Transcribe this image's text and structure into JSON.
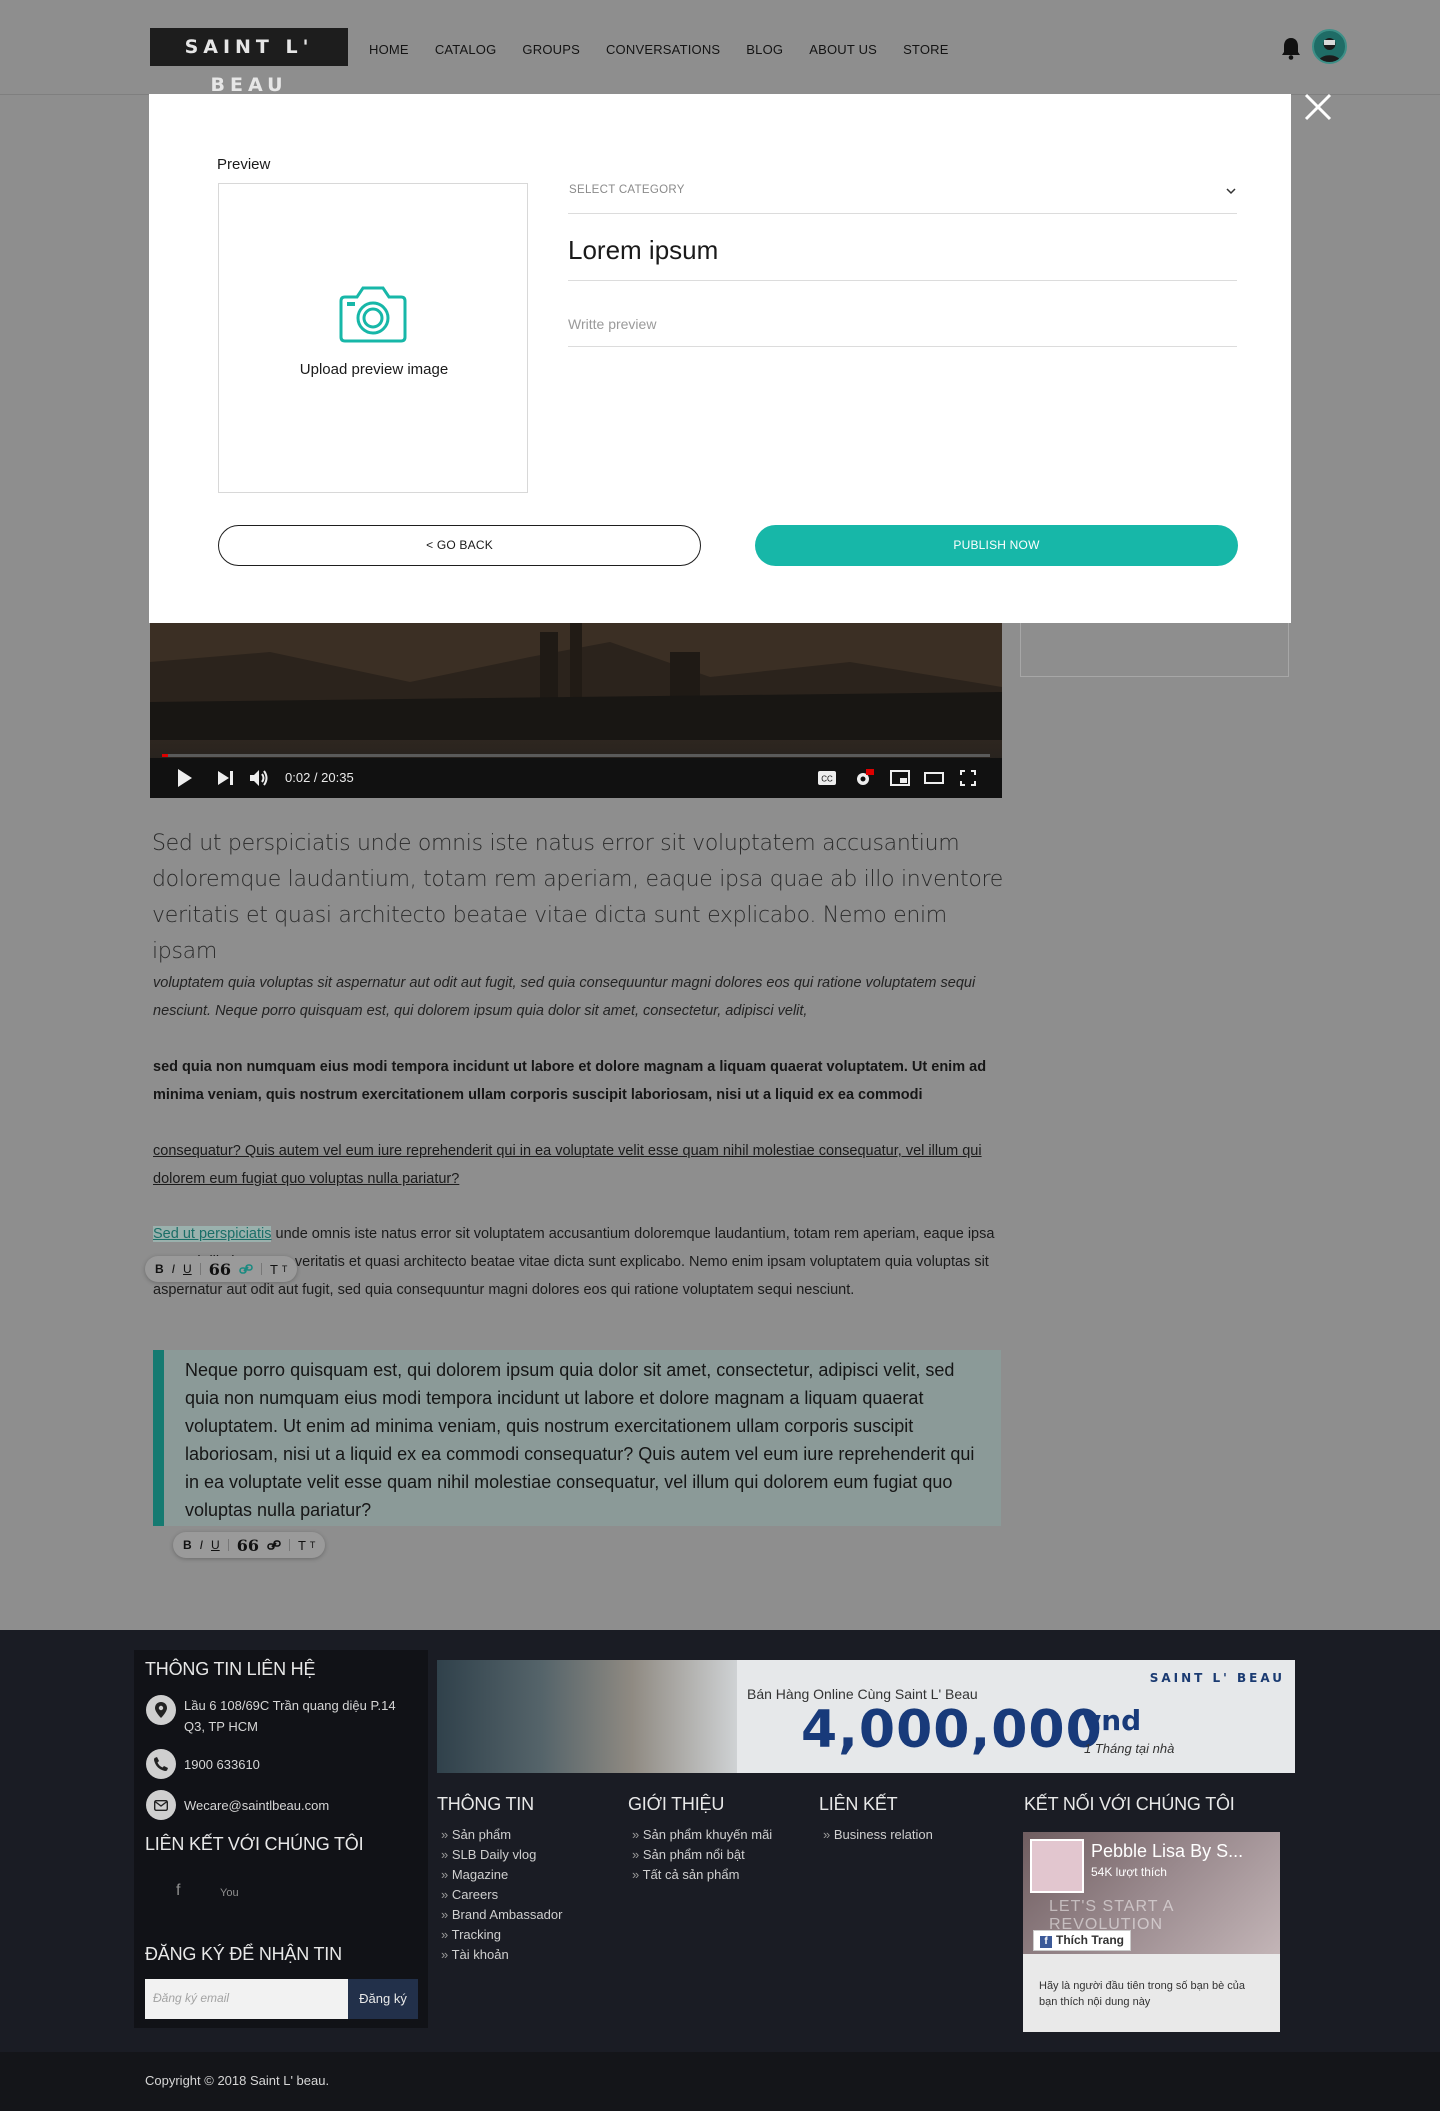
{
  "header": {
    "logo_text": "SAINT L' BEAU",
    "nav": [
      "HOME",
      "CATALOG",
      "GROUPS",
      "CONVERSATIONS",
      "BLOG",
      "ABOUT US",
      "STORE"
    ]
  },
  "video": {
    "time": "0:02 / 20:35",
    "progress_fraction": 0.001
  },
  "article": {
    "lead": "Sed ut perspiciatis unde omnis iste natus error sit voluptatem accusantium doloremque laudantium, totam rem aperiam, eaque ipsa quae ab illo inventore veritatis et quasi architecto beatae vitae dicta sunt explicabo. Nemo enim ipsam",
    "italic": "voluptatem quia voluptas sit aspernatur aut odit aut fugit, sed quia consequuntur magni dolores eos qui ratione voluptatem sequi nesciunt. Neque porro quisquam est, qui dolorem ipsum quia dolor sit amet, consectetur, adipisci velit,",
    "bold": "sed quia non numquam eius modi tempora incidunt ut labore et dolore magnam a liquam quaerat voluptatem. Ut enim ad minima veniam, quis nostrum exercitationem ullam corporis suscipit laboriosam, nisi ut a liquid ex ea commodi",
    "underlined": "consequatur? Quis autem vel eum iure reprehenderit qui in ea voluptate velit esse quam nihil molestiae consequatur, vel illum qui dolorem eum fugiat quo voluptas nulla pariatur?",
    "mixed_link": "Sed ut perspiciatis",
    "mixed_rest": " unde omnis iste natus error sit voluptatem accusantium doloremque laudantium, totam rem aperiam, eaque ipsa quae ab illo inventore veritatis et quasi architecto beatae vitae dicta sunt explicabo. Nemo enim ipsam voluptatem quia voluptas sit aspernatur aut odit aut fugit, sed quia consequuntur magni dolores eos qui ratione voluptatem sequi nesciunt.",
    "quote": "Neque porro quisquam est, qui dolorem ipsum quia dolor sit amet, consectetur, adipisci velit, sed  quia non numquam eius modi tempora incidunt ut labore et dolore magnam a liquam quaerat voluptatem. Ut enim ad minima veniam, quis nostrum exercitationem ullam corporis suscipit laboriosam, nisi ut a liquid ex ea commodi consequatur? Quis autem vel eum iure reprehenderit qui in ea voluptate velit esse quam nihil molestiae consequatur, vel illum qui dolorem eum fugiat quo voluptas nulla pariatur?"
  },
  "toolbar": {
    "bold": "B",
    "italic": "I",
    "underline": "U",
    "quote": "66",
    "title_large": "T",
    "title_small": "T"
  },
  "modal": {
    "preview_label": "Preview",
    "upload_text": "Upload preview image",
    "category_placeholder": "SELECT CATEGORY",
    "title_value": "Lorem ipsum",
    "description_placeholder": "Writte preview",
    "back_button": "< GO BACK",
    "publish_button": "PUBLISH NOW"
  },
  "footer": {
    "contact_heading": "THÔNG TIN LIÊN HỆ",
    "address": "Lầu 6 108/69C Trần quang diệu P.14 Q3, TP HCM",
    "phone": "1900 633610",
    "email": "Wecare@saintlbeau.com",
    "social_heading": "LIÊN KẾT VỚI CHÚNG TÔI",
    "social": [
      "f",
      "You"
    ],
    "newsletter_heading": "ĐĂNG KÝ ĐỂ NHẬN TIN",
    "newsletter_placeholder": "Đăng ký email",
    "newsletter_button": "Đăng ký",
    "banner": {
      "brand": "SAINT L' BEAU",
      "subtitle": "Bán Hàng Online Cùng Saint L' Beau",
      "amount": "4,000,000",
      "unit": "vnd",
      "note": "1 Tháng tại nhà"
    },
    "columns": [
      {
        "heading": "THÔNG TIN",
        "items": [
          "Sản phẩm",
          "SLB Daily vlog",
          "Magazine",
          "Careers",
          "Brand Ambassador",
          "Tracking",
          "Tài khoản"
        ]
      },
      {
        "heading": "GIỚI THIỆU",
        "items": [
          "Sản phẩm khuyến mãi",
          "Sản phẩm nổi bật",
          "Tất cả sản phẩm"
        ]
      },
      {
        "heading": "LIÊN KẾT",
        "items": [
          "Business relation"
        ]
      }
    ],
    "connect_heading": "KẾT NỐI VỚI CHÚNG TÔI",
    "facebook": {
      "page_name": "Pebble Lisa By S...",
      "likes": "54K lượt thích",
      "slogan": "LET'S START A REVOLUTION",
      "like_button": "Thích Trang",
      "friends_text": "Hãy là người đầu tiên trong số bạn bè của bạn thích nội dung này"
    },
    "copyright": "Copyright © 2018 Saint L' beau."
  },
  "colors": {
    "accent": "#17b7a8",
    "footer_bg": "#1a1c24",
    "overlay": "#8e8e8e"
  }
}
